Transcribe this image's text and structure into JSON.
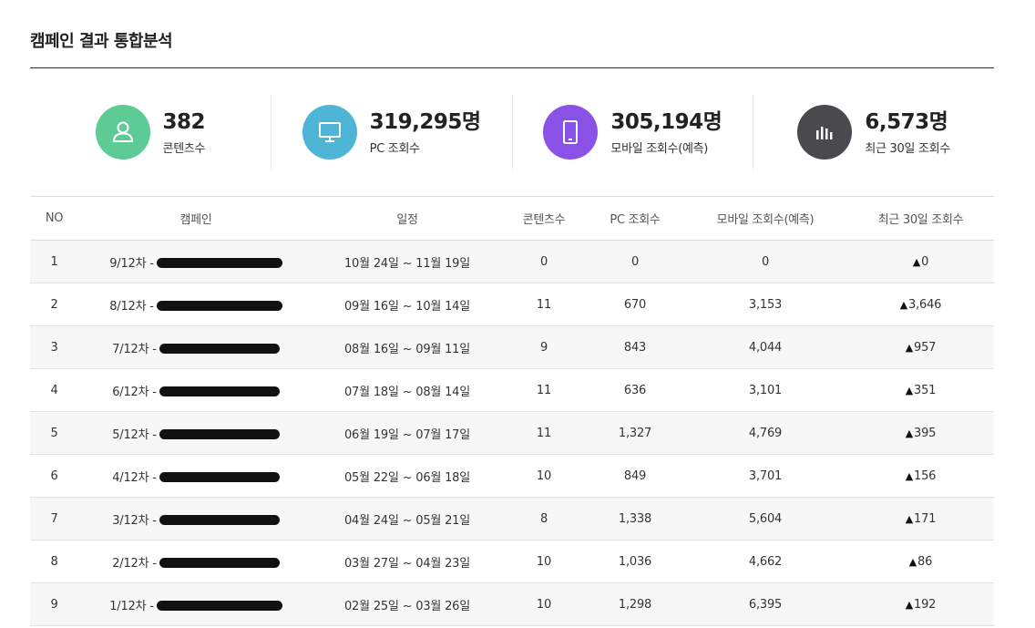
{
  "page": {
    "title": "캠페인 결과 통합분석"
  },
  "stats": [
    {
      "value": "382",
      "label": "콘텐츠수",
      "icon": "user-icon",
      "color": "#5ccb96"
    },
    {
      "value": "319,295명",
      "label": "PC 조회수",
      "icon": "monitor-icon",
      "color": "#4fb5d6"
    },
    {
      "value": "305,194명",
      "label": "모바일 조회수(예측)",
      "icon": "mobile-icon",
      "color": "#8a51e6"
    },
    {
      "value": "6,573명",
      "label": "최근 30일 조회수",
      "icon": "bar-chart-icon",
      "color": "#4a4a4e"
    }
  ],
  "table": {
    "headers": [
      "NO",
      "캠페인",
      "일정",
      "콘텐츠수",
      "PC 조회수",
      "모바일 조회수(예측)",
      "최근 30일 조회수"
    ],
    "rows": [
      {
        "no": "1",
        "campaign": "9/12차 -",
        "schedule": "10월 24일 ~ 11월 19일",
        "contents": "0",
        "pc": "0",
        "mobile": "0",
        "recent": "0"
      },
      {
        "no": "2",
        "campaign": "8/12차 -",
        "schedule": "09월 16일 ~ 10월 14일",
        "contents": "11",
        "pc": "670",
        "mobile": "3,153",
        "recent": "3,646"
      },
      {
        "no": "3",
        "campaign": "7/12차 -",
        "schedule": "08월 16일 ~ 09월 11일",
        "contents": "9",
        "pc": "843",
        "mobile": "4,044",
        "recent": "957"
      },
      {
        "no": "4",
        "campaign": "6/12차 -",
        "schedule": "07월 18일 ~ 08월 14일",
        "contents": "11",
        "pc": "636",
        "mobile": "3,101",
        "recent": "351"
      },
      {
        "no": "5",
        "campaign": "5/12차 -",
        "schedule": "06월 19일 ~ 07월 17일",
        "contents": "11",
        "pc": "1,327",
        "mobile": "4,769",
        "recent": "395"
      },
      {
        "no": "6",
        "campaign": "4/12차 -",
        "schedule": "05월 22일 ~ 06월 18일",
        "contents": "10",
        "pc": "849",
        "mobile": "3,701",
        "recent": "156"
      },
      {
        "no": "7",
        "campaign": "3/12차 -",
        "schedule": "04월 24일 ~ 05월 21일",
        "contents": "8",
        "pc": "1,338",
        "mobile": "5,604",
        "recent": "171"
      },
      {
        "no": "8",
        "campaign": "2/12차 -",
        "schedule": "03월 27일 ~ 04월 23일",
        "contents": "10",
        "pc": "1,036",
        "mobile": "4,662",
        "recent": "86"
      },
      {
        "no": "9",
        "campaign": "1/12차 -",
        "schedule": "02월 25일 ~ 03월 26일",
        "contents": "10",
        "pc": "1,298",
        "mobile": "6,395",
        "recent": "192"
      }
    ]
  }
}
